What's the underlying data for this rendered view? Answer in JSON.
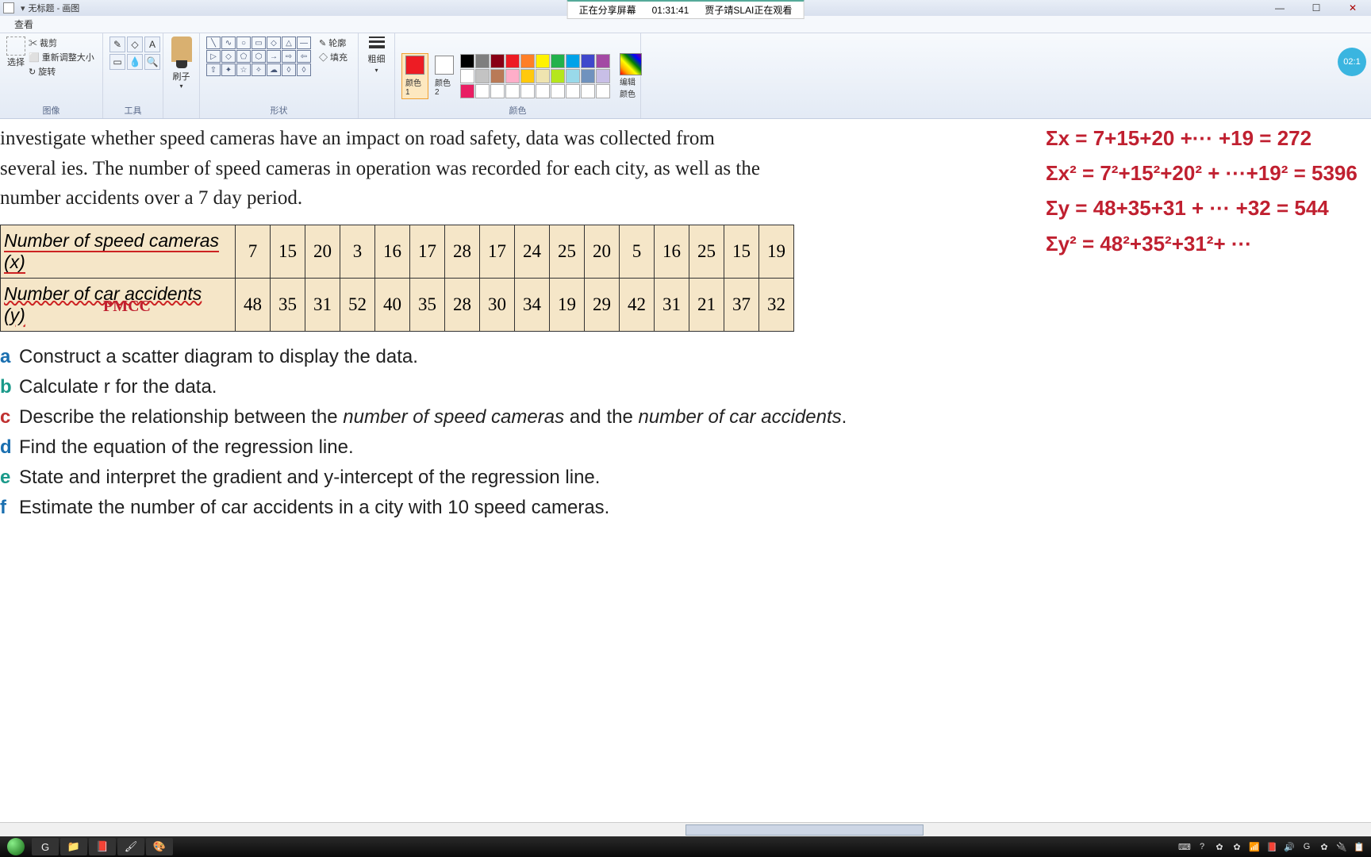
{
  "title": {
    "doc": "无标题",
    "app": "画图"
  },
  "share_banner": {
    "status": "正在分享屏幕",
    "time": "01:31:41",
    "viewer": "贾子靖SLAI正在观看"
  },
  "menu": {
    "view": "查看"
  },
  "ribbon": {
    "image": {
      "label": "图像",
      "select": "选择",
      "crop": "✂ 裁剪",
      "resize": "⬜ 重新调整大小",
      "rotate": "↻ 旋转"
    },
    "tools": {
      "label": "工具",
      "pencil": "✎",
      "fill": "◇",
      "text": "A",
      "eraser": "▭",
      "picker": "💧",
      "zoom": "🔍"
    },
    "brush": {
      "label": "刷子"
    },
    "shapes": {
      "label": "形状",
      "outline": "✎ 轮廓",
      "fill": "◇ 填充"
    },
    "stroke": {
      "label": "粗细"
    },
    "colors": {
      "label": "颜色",
      "color1": "颜色 1",
      "color2": "颜色 2",
      "edit": "编辑颜色"
    }
  },
  "timer": "02:1",
  "problem": {
    "para": "investigate whether speed cameras have an impact on road safety, data was collected from several ies. The number of speed cameras in operation was recorded for each city, as well as the number accidents over a 7 day period.",
    "row_x_label": "Number of speed cameras (x)",
    "row_y_label": "Number of car accidents (y)",
    "row_x": [
      "7",
      "15",
      "20",
      "3",
      "16",
      "17",
      "28",
      "17",
      "24",
      "25",
      "20",
      "5",
      "16",
      "25",
      "15",
      "19"
    ],
    "row_y": [
      "48",
      "35",
      "31",
      "52",
      "40",
      "35",
      "28",
      "30",
      "34",
      "19",
      "29",
      "42",
      "31",
      "21",
      "37",
      "32"
    ],
    "q_a": "Construct a scatter diagram to display the data.",
    "q_b": "Calculate r for the data.",
    "q_c_pre": "Describe the relationship between the ",
    "q_c_i1": "number of speed cameras",
    "q_c_mid": " and the ",
    "q_c_i2": "number of car accidents",
    "q_c_post": ".",
    "q_d": "Find the equation of the regression line.",
    "q_e": "State and interpret the gradient and y-intercept of the regression line.",
    "q_f": "Estimate the number of car accidents in a city with 10 speed cameras.",
    "pmcc": "PMCC"
  },
  "handwriting": {
    "l1": "Σx = 7+15+20 +··· +19 = 272",
    "l2": "Σx² = 7²+15²+20² + ···+19² = 5396",
    "l3": "Σy = 48+35+31 + ··· +32 = 544",
    "l4": "Σy² = 48²+35²+31²+ ···"
  },
  "chart_data": {
    "type": "table",
    "title": "Speed cameras vs car accidents",
    "series": [
      {
        "name": "Number of speed cameras (x)",
        "values": [
          7,
          15,
          20,
          3,
          16,
          17,
          28,
          17,
          24,
          25,
          20,
          5,
          16,
          25,
          15,
          19
        ]
      },
      {
        "name": "Number of car accidents (y)",
        "values": [
          48,
          35,
          31,
          52,
          40,
          35,
          28,
          30,
          34,
          19,
          29,
          42,
          31,
          21,
          37,
          32
        ]
      }
    ]
  },
  "palette_colors_row1": [
    "#000",
    "#7f7f7f",
    "#880015",
    "#ed1c24",
    "#ff7f27",
    "#fff200",
    "#22b14c",
    "#00a2e8",
    "#3f48cc",
    "#a349a4"
  ],
  "palette_colors_row2": [
    "#fff",
    "#c3c3c3",
    "#b97a57",
    "#ffaec9",
    "#ffc90e",
    "#efe4b0",
    "#b5e61d",
    "#99d9ea",
    "#7092be",
    "#c8bfe7"
  ],
  "palette_colors_row3": [
    "#e91e63",
    "#fff",
    "#fff",
    "#fff",
    "#fff",
    "#fff",
    "#fff",
    "#fff",
    "#fff",
    "#fff"
  ],
  "taskbar_icons": [
    "G",
    "📁",
    "📕",
    "🖌",
    "🎨"
  ],
  "tray_icons": [
    "⌨",
    "?",
    "✿",
    "✿",
    "📶",
    "📕",
    "🔊",
    "G",
    "✿",
    "🔌",
    "📋"
  ]
}
